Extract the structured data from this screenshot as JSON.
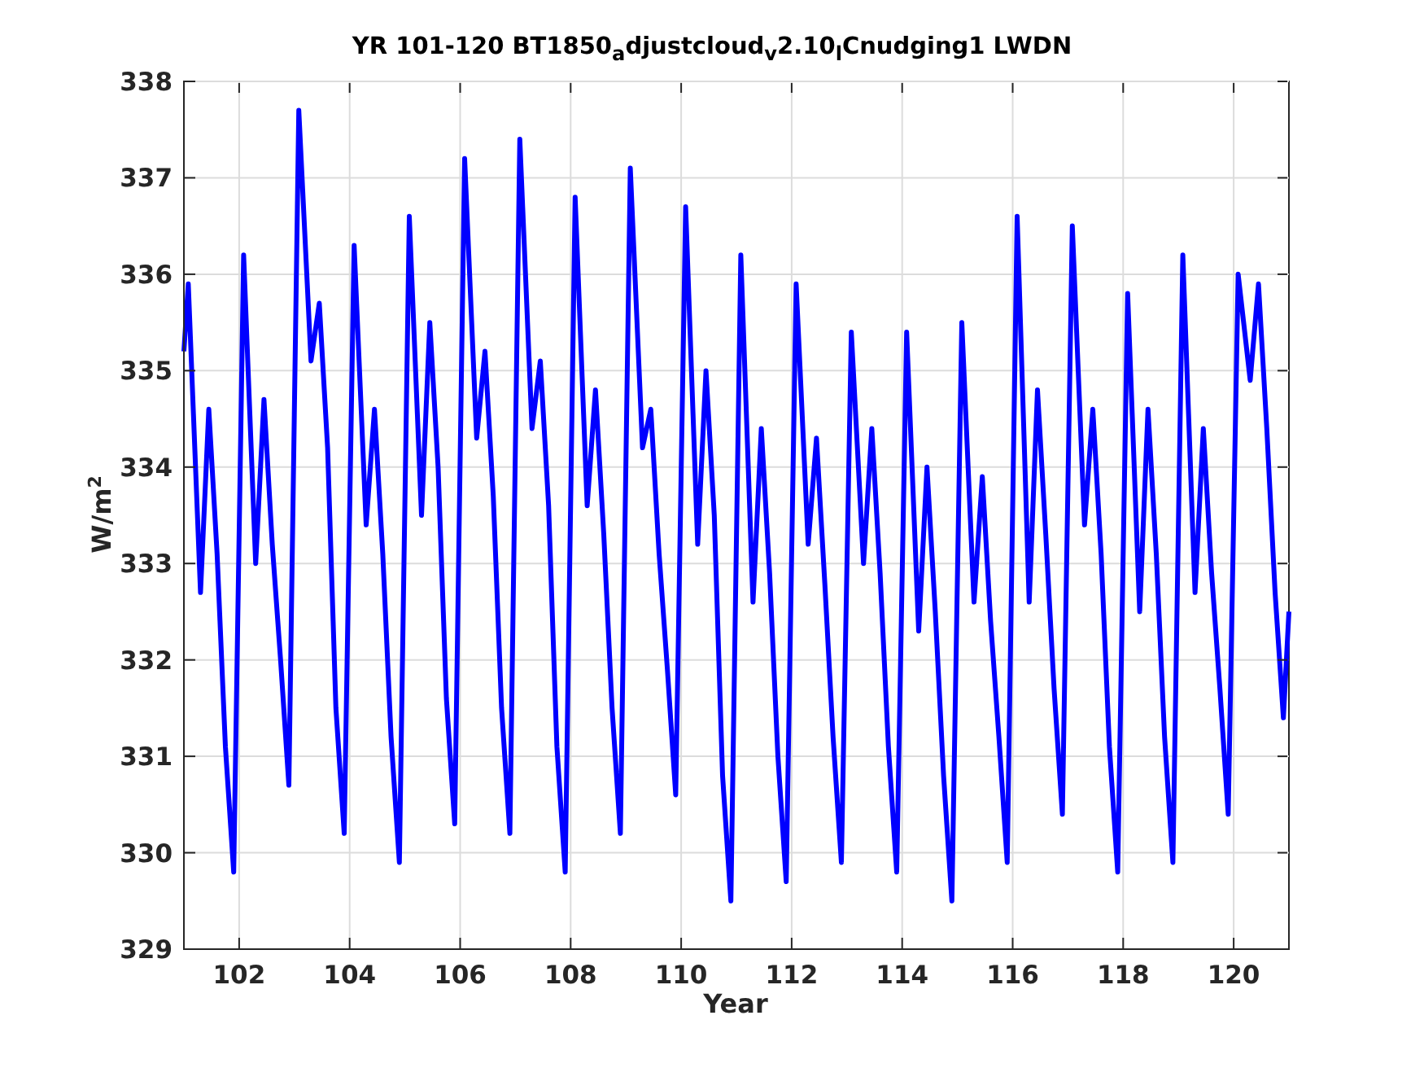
{
  "figure": {
    "chart_data": {
      "type": "line",
      "grid": true,
      "title": "YR 101-120 BT1850$_{a}$djustcloud$_{v}$2.10$_{l}$Cnudging1 LWDN",
      "xlabel": "Year",
      "ylabel": "W/m$^{2}$",
      "x": [
        101.0,
        101.08,
        101.3,
        101.45,
        101.6,
        101.75,
        101.9,
        102.08,
        102.3,
        102.45,
        102.6,
        102.75,
        102.9,
        103.08,
        103.3,
        103.45,
        103.6,
        103.75,
        103.9,
        104.08,
        104.3,
        104.45,
        104.6,
        104.75,
        104.9,
        105.08,
        105.3,
        105.45,
        105.6,
        105.75,
        105.9,
        106.08,
        106.3,
        106.45,
        106.6,
        106.75,
        106.9,
        107.08,
        107.3,
        107.45,
        107.6,
        107.75,
        107.9,
        108.08,
        108.3,
        108.45,
        108.6,
        108.75,
        108.9,
        109.08,
        109.3,
        109.45,
        109.6,
        109.75,
        109.9,
        110.08,
        110.3,
        110.45,
        110.6,
        110.75,
        110.9,
        111.08,
        111.3,
        111.45,
        111.6,
        111.75,
        111.9,
        112.08,
        112.3,
        112.45,
        112.6,
        112.75,
        112.9,
        113.08,
        113.3,
        113.45,
        113.6,
        113.75,
        113.9,
        114.08,
        114.3,
        114.45,
        114.6,
        114.75,
        114.9,
        115.08,
        115.3,
        115.45,
        115.6,
        115.75,
        115.9,
        116.08,
        116.3,
        116.45,
        116.6,
        116.75,
        116.9,
        117.08,
        117.3,
        117.45,
        117.6,
        117.75,
        117.9,
        118.08,
        118.3,
        118.45,
        118.6,
        118.75,
        118.9,
        119.08,
        119.3,
        119.45,
        119.6,
        119.75,
        119.9,
        120.08,
        120.3,
        120.45,
        120.6,
        120.75,
        120.9,
        121.0
      ],
      "series": [
        {
          "color": "#0000ff",
          "values": [
            335.2,
            335.9,
            332.7,
            334.6,
            333.1,
            331.1,
            329.8,
            336.2,
            333.0,
            334.7,
            333.2,
            332.0,
            330.7,
            337.7,
            335.1,
            335.7,
            334.2,
            331.5,
            330.2,
            336.3,
            333.4,
            334.6,
            333.1,
            331.2,
            329.9,
            336.6,
            333.5,
            335.5,
            334.0,
            331.6,
            330.3,
            337.2,
            334.3,
            335.2,
            333.7,
            331.5,
            330.2,
            337.4,
            334.4,
            335.1,
            333.6,
            331.1,
            329.8,
            336.8,
            333.6,
            334.8,
            333.3,
            331.5,
            330.2,
            337.1,
            334.2,
            334.6,
            333.1,
            331.9,
            330.6,
            336.7,
            333.2,
            335.0,
            333.5,
            330.8,
            329.5,
            336.2,
            332.6,
            334.4,
            332.9,
            331.0,
            329.7,
            335.9,
            333.2,
            334.3,
            332.8,
            331.2,
            329.9,
            335.4,
            333.0,
            334.4,
            332.9,
            331.1,
            329.8,
            335.4,
            332.3,
            334.0,
            332.5,
            330.8,
            329.5,
            335.5,
            332.6,
            333.9,
            332.4,
            331.2,
            329.9,
            336.6,
            332.6,
            334.8,
            333.3,
            331.7,
            330.4,
            336.5,
            333.4,
            334.6,
            333.1,
            331.1,
            329.8,
            335.8,
            332.5,
            334.6,
            333.1,
            331.2,
            329.9,
            336.2,
            332.7,
            334.4,
            332.9,
            331.7,
            330.4,
            336.0,
            334.9,
            335.9,
            334.4,
            332.7,
            331.4,
            332.5
          ]
        }
      ],
      "xlim": [
        101,
        121
      ],
      "ylim": [
        329,
        338
      ],
      "xticks": [
        102,
        104,
        106,
        108,
        110,
        112,
        114,
        116,
        118,
        120
      ],
      "yticks": [
        329,
        330,
        331,
        332,
        333,
        334,
        335,
        336,
        337,
        338
      ]
    }
  }
}
